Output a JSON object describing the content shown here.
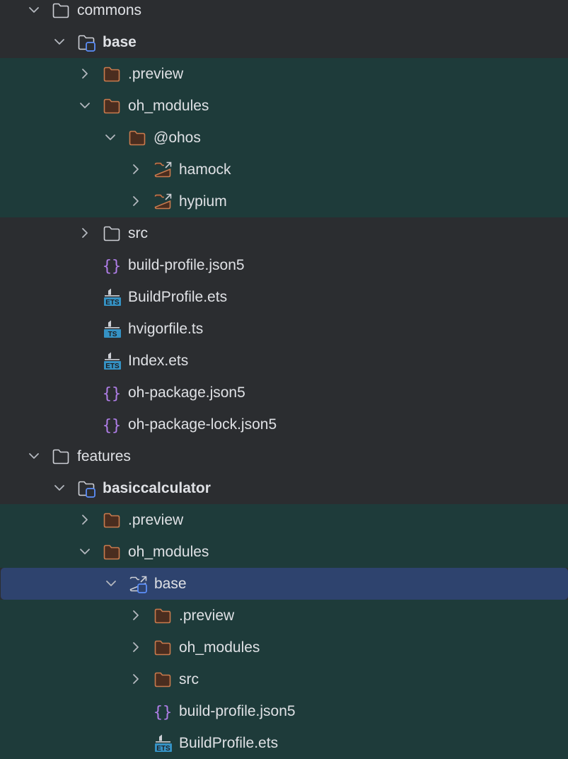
{
  "tree": [
    {
      "label": "commons",
      "level": 0,
      "chevron": "down",
      "icon": "folder-icon",
      "bg": "none",
      "bold": false
    },
    {
      "label": "base",
      "level": 1,
      "chevron": "down",
      "icon": "module-folder-icon",
      "bg": "none",
      "bold": true
    },
    {
      "label": ".preview",
      "level": 2,
      "chevron": "right",
      "icon": "excluded-folder-icon",
      "bg": "excluded",
      "bold": false
    },
    {
      "label": "oh_modules",
      "level": 2,
      "chevron": "down",
      "icon": "excluded-folder-icon",
      "bg": "excluded",
      "bold": false
    },
    {
      "label": "@ohos",
      "level": 3,
      "chevron": "down",
      "icon": "excluded-folder-icon",
      "bg": "excluded",
      "bold": false
    },
    {
      "label": "hamock",
      "level": 4,
      "chevron": "right",
      "icon": "symlink-folder-icon",
      "bg": "excluded",
      "bold": false
    },
    {
      "label": "hypium",
      "level": 4,
      "chevron": "right",
      "icon": "symlink-folder-icon",
      "bg": "excluded",
      "bold": false
    },
    {
      "label": "src",
      "level": 2,
      "chevron": "right",
      "icon": "folder-icon",
      "bg": "none",
      "bold": false
    },
    {
      "label": "build-profile.json5",
      "level": 2,
      "chevron": "none",
      "icon": "json5-file-icon",
      "bg": "none",
      "bold": false
    },
    {
      "label": "BuildProfile.ets",
      "level": 2,
      "chevron": "none",
      "icon": "ets-file-icon",
      "bg": "none",
      "bold": false
    },
    {
      "label": "hvigorfile.ts",
      "level": 2,
      "chevron": "none",
      "icon": "ts-file-icon",
      "bg": "none",
      "bold": false
    },
    {
      "label": "Index.ets",
      "level": 2,
      "chevron": "none",
      "icon": "ets-file-icon",
      "bg": "none",
      "bold": false
    },
    {
      "label": "oh-package.json5",
      "level": 2,
      "chevron": "none",
      "icon": "json5-file-icon",
      "bg": "none",
      "bold": false
    },
    {
      "label": "oh-package-lock.json5",
      "level": 2,
      "chevron": "none",
      "icon": "json5-file-icon",
      "bg": "none",
      "bold": false
    },
    {
      "label": "features",
      "level": 0,
      "chevron": "down",
      "icon": "folder-icon",
      "bg": "none",
      "bold": false
    },
    {
      "label": "basiccalculator",
      "level": 1,
      "chevron": "down",
      "icon": "module-folder-icon",
      "bg": "none",
      "bold": true
    },
    {
      "label": ".preview",
      "level": 2,
      "chevron": "right",
      "icon": "excluded-folder-icon",
      "bg": "excluded",
      "bold": false
    },
    {
      "label": "oh_modules",
      "level": 2,
      "chevron": "down",
      "icon": "excluded-folder-icon",
      "bg": "excluded",
      "bold": false
    },
    {
      "label": "base",
      "level": 3,
      "chevron": "down",
      "icon": "symlink-module-icon",
      "bg": "selected",
      "bold": false
    },
    {
      "label": ".preview",
      "level": 4,
      "chevron": "right",
      "icon": "excluded-folder-icon",
      "bg": "excluded",
      "bold": false
    },
    {
      "label": "oh_modules",
      "level": 4,
      "chevron": "right",
      "icon": "excluded-folder-icon",
      "bg": "excluded",
      "bold": false
    },
    {
      "label": "src",
      "level": 4,
      "chevron": "right",
      "icon": "excluded-folder-icon",
      "bg": "excluded",
      "bold": false
    },
    {
      "label": "build-profile.json5",
      "level": 4,
      "chevron": "none",
      "icon": "json5-file-icon",
      "bg": "excluded",
      "bold": false
    },
    {
      "label": "BuildProfile.ets",
      "level": 4,
      "chevron": "none",
      "icon": "ets-file-icon",
      "bg": "excluded",
      "bold": false
    }
  ],
  "colors": {
    "panel_bg": "#2b2d30",
    "excluded_bg": "#1e3b3a",
    "selected_bg": "#2e436e",
    "text": "#dfe1e5",
    "folder_stroke": "#ced0d6",
    "excluded_folder_stroke": "#c97a4d",
    "module_accent": "#5c8ffa",
    "json_brace": "#b07ee8",
    "file_badge": "#3592c4"
  }
}
